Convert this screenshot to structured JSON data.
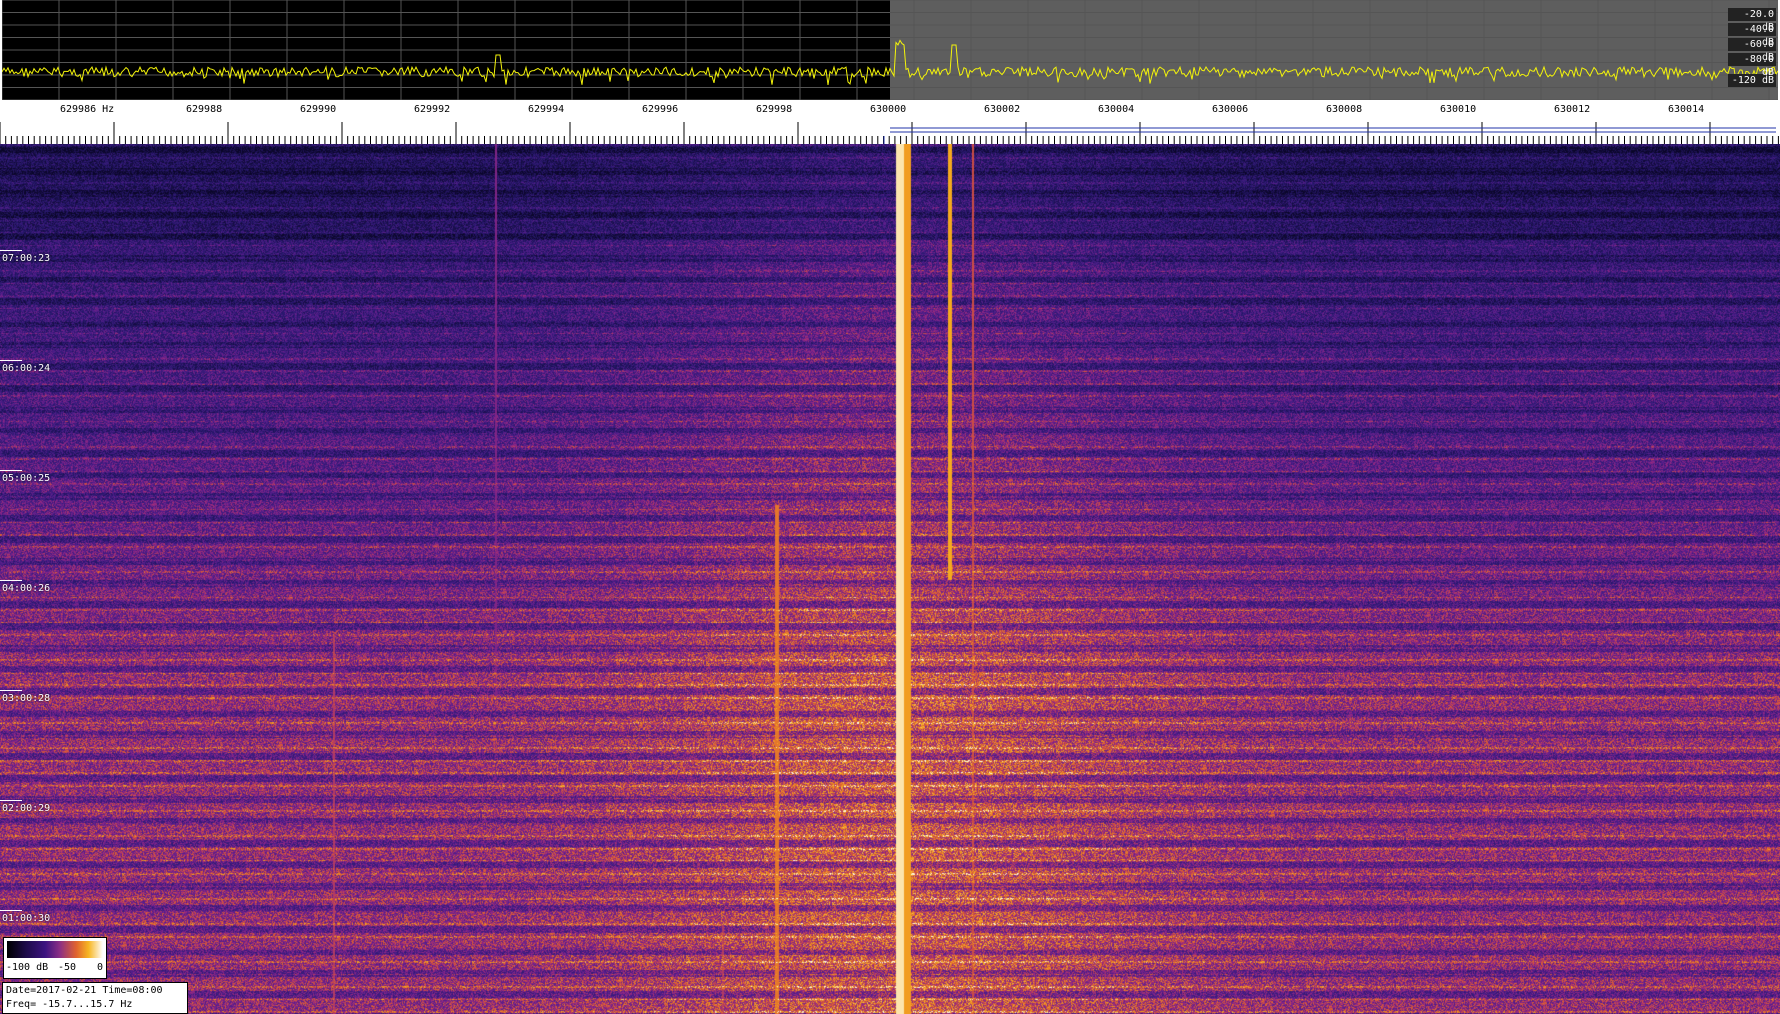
{
  "spectrum": {
    "db_labels": [
      "-20.0 dB",
      "-40.0 dB",
      "-60.0 dB",
      "-80.0 dB",
      "-120 dB"
    ],
    "colors": {
      "left_bg": "#000000",
      "right_bg": "#5e5e5e",
      "trace": "#f4f40a"
    }
  },
  "frequency_axis": {
    "labels": [
      "629986 Hz",
      "629988",
      "629990",
      "629992",
      "629994",
      "629996",
      "629998",
      "630000",
      "630002",
      "630004",
      "630006",
      "630008",
      "630010",
      "630012",
      "630014"
    ]
  },
  "waterfall": {
    "time_labels": [
      "07:00:23",
      "06:00:24",
      "05:00:25",
      "04:00:26",
      "03:00:28",
      "02:00:29",
      "01:00:30"
    ]
  },
  "colorbar": {
    "min_label": "-100 dB",
    "mid_label": "-50",
    "max_label": "0"
  },
  "info": {
    "date_line": "Date=2017-02-21 Time=08:00",
    "freq_line": "Freq= -15.7...15.7 Hz"
  }
}
